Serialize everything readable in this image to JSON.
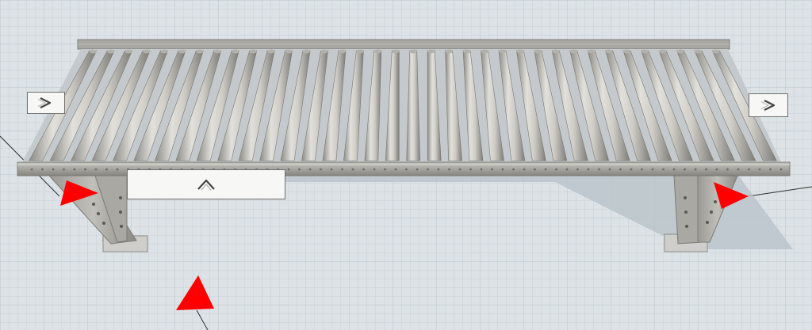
{
  "scene": {
    "background": "#d9dfe3",
    "grid_minor_color": "#c9d3da",
    "grid_major_color": "#b5c2cb",
    "object": "roller-conveyor",
    "roller_count": 36,
    "frame_color": "#a3a29d",
    "roller_color": "#c8c6bf",
    "handle_color": "#ff0000"
  },
  "handles": [
    {
      "name": "left-leg-handle",
      "direction": "right"
    },
    {
      "name": "right-leg-handle",
      "direction": "right"
    },
    {
      "name": "floor-handle",
      "direction": "up"
    }
  ],
  "connectors": {
    "input": {
      "icon": "chevron-right-icon"
    },
    "output": {
      "icon": "chevron-right-icon"
    },
    "side": {
      "icon": "chevron-up-icon"
    }
  }
}
